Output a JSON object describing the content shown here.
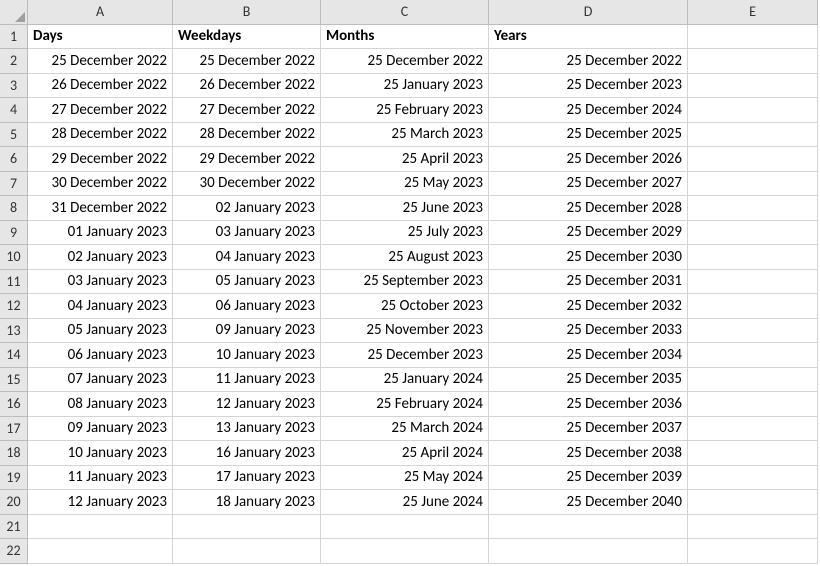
{
  "columns": [
    "A",
    "B",
    "C",
    "D",
    "E"
  ],
  "row_numbers": [
    1,
    2,
    3,
    4,
    5,
    6,
    7,
    8,
    9,
    10,
    11,
    12,
    13,
    14,
    15,
    16,
    17,
    18,
    19,
    20,
    21,
    22
  ],
  "headers": {
    "A": "Days",
    "B": "Weekdays",
    "C": "Months",
    "D": "Years",
    "E": ""
  },
  "data": {
    "A": [
      "25 December 2022",
      "26 December 2022",
      "27 December 2022",
      "28 December 2022",
      "29 December 2022",
      "30 December 2022",
      "31 December 2022",
      "01 January 2023",
      "02 January 2023",
      "03 January 2023",
      "04 January 2023",
      "05 January 2023",
      "06 January 2023",
      "07 January 2023",
      "08 January 2023",
      "09 January 2023",
      "10 January 2023",
      "11 January 2023",
      "12 January 2023"
    ],
    "B": [
      "25 December 2022",
      "26 December 2022",
      "27 December 2022",
      "28 December 2022",
      "29 December 2022",
      "30 December 2022",
      "02 January 2023",
      "03 January 2023",
      "04 January 2023",
      "05 January 2023",
      "06 January 2023",
      "09 January 2023",
      "10 January 2023",
      "11 January 2023",
      "12 January 2023",
      "13 January 2023",
      "16 January 2023",
      "17 January 2023",
      "18 January 2023"
    ],
    "C": [
      "25 December 2022",
      "25 January 2023",
      "25 February 2023",
      "25 March 2023",
      "25 April 2023",
      "25 May 2023",
      "25 June 2023",
      "25 July 2023",
      "25 August 2023",
      "25 September 2023",
      "25 October 2023",
      "25 November 2023",
      "25 December 2023",
      "25 January 2024",
      "25 February 2024",
      "25 March 2024",
      "25 April 2024",
      "25 May 2024",
      "25 June 2024"
    ],
    "D": [
      "25 December 2022",
      "25 December 2023",
      "25 December 2024",
      "25 December 2025",
      "25 December 2026",
      "25 December 2027",
      "25 December 2028",
      "25 December 2029",
      "25 December 2030",
      "25 December 2031",
      "25 December 2032",
      "25 December 2033",
      "25 December 2034",
      "25 December 2035",
      "25 December 2036",
      "25 December 2037",
      "25 December 2038",
      "25 December 2039",
      "25 December 2040"
    ],
    "E": []
  },
  "chart_data": {
    "type": "table",
    "title": "",
    "columns": [
      "Days",
      "Weekdays",
      "Months",
      "Years"
    ],
    "rows": [
      [
        "25 December 2022",
        "25 December 2022",
        "25 December 2022",
        "25 December 2022"
      ],
      [
        "26 December 2022",
        "26 December 2022",
        "25 January 2023",
        "25 December 2023"
      ],
      [
        "27 December 2022",
        "27 December 2022",
        "25 February 2023",
        "25 December 2024"
      ],
      [
        "28 December 2022",
        "28 December 2022",
        "25 March 2023",
        "25 December 2025"
      ],
      [
        "29 December 2022",
        "29 December 2022",
        "25 April 2023",
        "25 December 2026"
      ],
      [
        "30 December 2022",
        "30 December 2022",
        "25 May 2023",
        "25 December 2027"
      ],
      [
        "31 December 2022",
        "02 January 2023",
        "25 June 2023",
        "25 December 2028"
      ],
      [
        "01 January 2023",
        "03 January 2023",
        "25 July 2023",
        "25 December 2029"
      ],
      [
        "02 January 2023",
        "04 January 2023",
        "25 August 2023",
        "25 December 2030"
      ],
      [
        "03 January 2023",
        "05 January 2023",
        "25 September 2023",
        "25 December 2031"
      ],
      [
        "04 January 2023",
        "06 January 2023",
        "25 October 2023",
        "25 December 2032"
      ],
      [
        "05 January 2023",
        "09 January 2023",
        "25 November 2023",
        "25 December 2033"
      ],
      [
        "06 January 2023",
        "10 January 2023",
        "25 December 2023",
        "25 December 2034"
      ],
      [
        "07 January 2023",
        "11 January 2023",
        "25 January 2024",
        "25 December 2035"
      ],
      [
        "08 January 2023",
        "12 January 2023",
        "25 February 2024",
        "25 December 2036"
      ],
      [
        "09 January 2023",
        "13 January 2023",
        "25 March 2024",
        "25 December 2037"
      ],
      [
        "10 January 2023",
        "16 January 2023",
        "25 April 2024",
        "25 December 2038"
      ],
      [
        "11 January 2023",
        "17 January 2023",
        "25 May 2024",
        "25 December 2039"
      ],
      [
        "12 January 2023",
        "18 January 2023",
        "25 June 2024",
        "25 December 2040"
      ]
    ]
  }
}
